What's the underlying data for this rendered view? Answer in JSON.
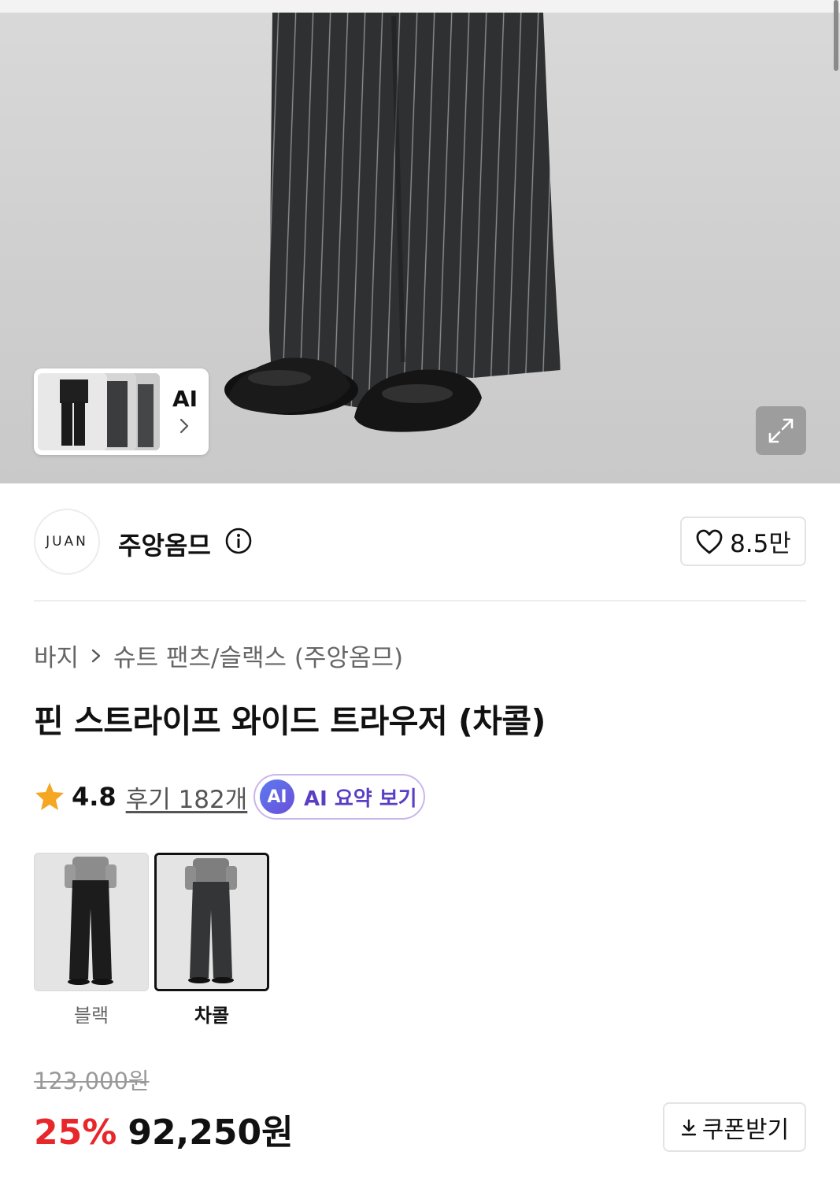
{
  "hero": {
    "ai_thumbnail_label": "AI"
  },
  "brand": {
    "logo_text": "JUAN",
    "name": "주앙옴므",
    "likes": "8.5만"
  },
  "breadcrumb": {
    "category": "바지",
    "subcategory": "슈트 팬츠/슬랙스 (주앙옴므)"
  },
  "product": {
    "title": "핀 스트라이프 와이드 트라우저 (차콜)"
  },
  "rating": {
    "score": "4.8",
    "reviews": "후기 182개",
    "ai_badge": "AI",
    "ai_summary": "AI 요약 보기"
  },
  "options": [
    {
      "label": "블랙",
      "selected": false
    },
    {
      "label": "차콜",
      "selected": true
    }
  ],
  "price": {
    "original": "123,000원",
    "discount": "25%",
    "sale": "92,250원",
    "coupon_label": "쿠폰받기"
  },
  "colors": {
    "discount_red": "#e8272b",
    "ai_purple": "#5a3fc4",
    "star_orange": "#f5a623"
  },
  "icons": [
    "expand-icon",
    "chevron-right-icon",
    "info-icon",
    "heart-icon",
    "star-icon",
    "download-icon"
  ]
}
